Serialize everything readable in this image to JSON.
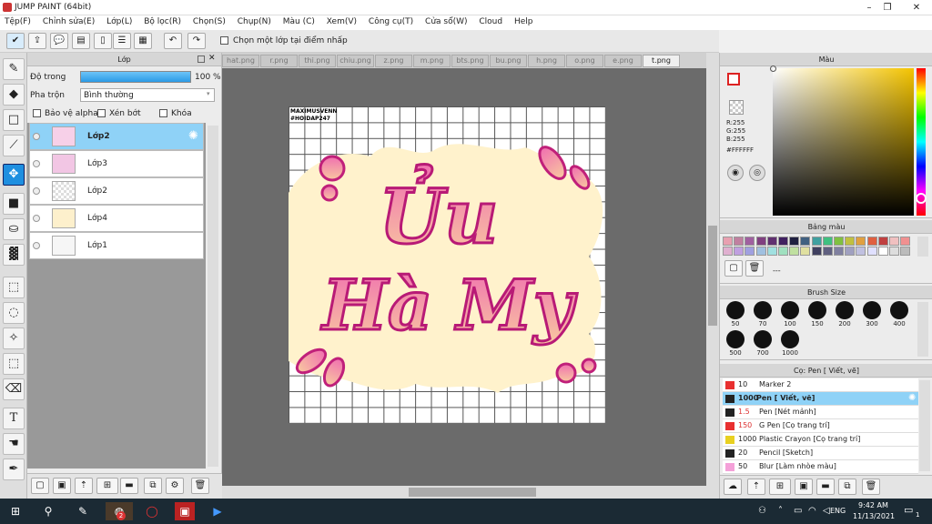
{
  "app": {
    "title": "JUMP PAINT (64bit)"
  },
  "menu": [
    "Tệp(F)",
    "Chỉnh sửa(E)",
    "Lớp(L)",
    "Bộ lọc(R)",
    "Chọn(S)",
    "Chụp(N)",
    "Màu (C)",
    "Xem(V)",
    "Công cụ(T)",
    "Cửa sổ(W)",
    "Cloud",
    "Help"
  ],
  "toolbar": {
    "select_from_point": "Chọn một lớp tại điểm nhấp"
  },
  "layer_panel": {
    "title": "Lớp",
    "opacity_label": "Độ trong",
    "opacity_value": "100 %",
    "opacity_fraction": 1.0,
    "blend_label": "Pha trộn",
    "blend_value": "Bình thường",
    "protect_alpha": "Bảo vệ alpha",
    "clipping": "Xén bớt",
    "lock": "Khóa",
    "layers": [
      {
        "name": "Lớp2",
        "selected": true
      },
      {
        "name": "Lớp3"
      },
      {
        "name": "Lớp2"
      },
      {
        "name": "Lớp4"
      },
      {
        "name": "Lớp1"
      }
    ]
  },
  "tabs": [
    "hat.png",
    "r.png",
    "thi.png",
    "chiu.png",
    "z.png",
    "m.png",
    "bts.png",
    "bu.png",
    "h.png",
    "o.png",
    "e.png",
    "t.png"
  ],
  "canvas": {
    "watermark1": "MAXIMUSVENN",
    "watermark2": "#HOIDAP247",
    "line1": "Ủu",
    "line2": "Hà My"
  },
  "color_panel": {
    "title": "Màu",
    "r": "R:255",
    "g": "G:255",
    "b": "B:255",
    "hex": "#FFFFFF"
  },
  "palette": {
    "title": "Bảng màu",
    "dash": "---",
    "colors": [
      "#e8a0b0",
      "#c080a0",
      "#a060a0",
      "#804080",
      "#603070",
      "#402060",
      "#202040",
      "#406080",
      "#40a0a0",
      "#40c080",
      "#80c040",
      "#c0c040",
      "#e0a040",
      "#e06040",
      "#c04040",
      "#f0c0c0",
      "#f09090",
      "#e0b0d0",
      "#c0a0e0",
      "#a0a0e0",
      "#a0c0e0",
      "#a0e0e0",
      "#a0e0c0",
      "#c0e0a0",
      "#e0e0a0",
      "#404060",
      "#606080",
      "#8080a0",
      "#a0a0c0",
      "#c0c0e0",
      "#e0e0ff",
      "#ffffff",
      "#dddddd",
      "#bbbbbb"
    ]
  },
  "brush_size": {
    "title": "Brush Size",
    "sizes": [
      "50",
      "70",
      "100",
      "150",
      "200",
      "300",
      "400",
      "500",
      "700",
      "1000"
    ]
  },
  "pen_panel": {
    "title": "Cọ: Pen [ Viết, vẽ]",
    "items": [
      {
        "color": "#e83030",
        "size": "10",
        "name": "Marker 2"
      },
      {
        "color": "#222222",
        "size": "1000",
        "name": "Pen [ Viết, vẽ]",
        "selected": true
      },
      {
        "color": "#222222",
        "size": "1.5",
        "name": "Pen [Nét mảnh]"
      },
      {
        "color": "#e83030",
        "size": "150",
        "name": "G Pen [Cọ trang trí]"
      },
      {
        "color": "#e8d020",
        "size": "1000",
        "name": "Plastic Crayon [Cọ trang trí]"
      },
      {
        "color": "#222222",
        "size": "20",
        "name": "Pencil [Sketch]"
      },
      {
        "color": "#f4a0d8",
        "size": "50",
        "name": "Blur [Làm nhòe màu]"
      }
    ]
  },
  "taskbar": {
    "lang": "ENG",
    "time": "9:42 AM",
    "date": "11/13/2021",
    "badge": "2",
    "notif": "1"
  }
}
